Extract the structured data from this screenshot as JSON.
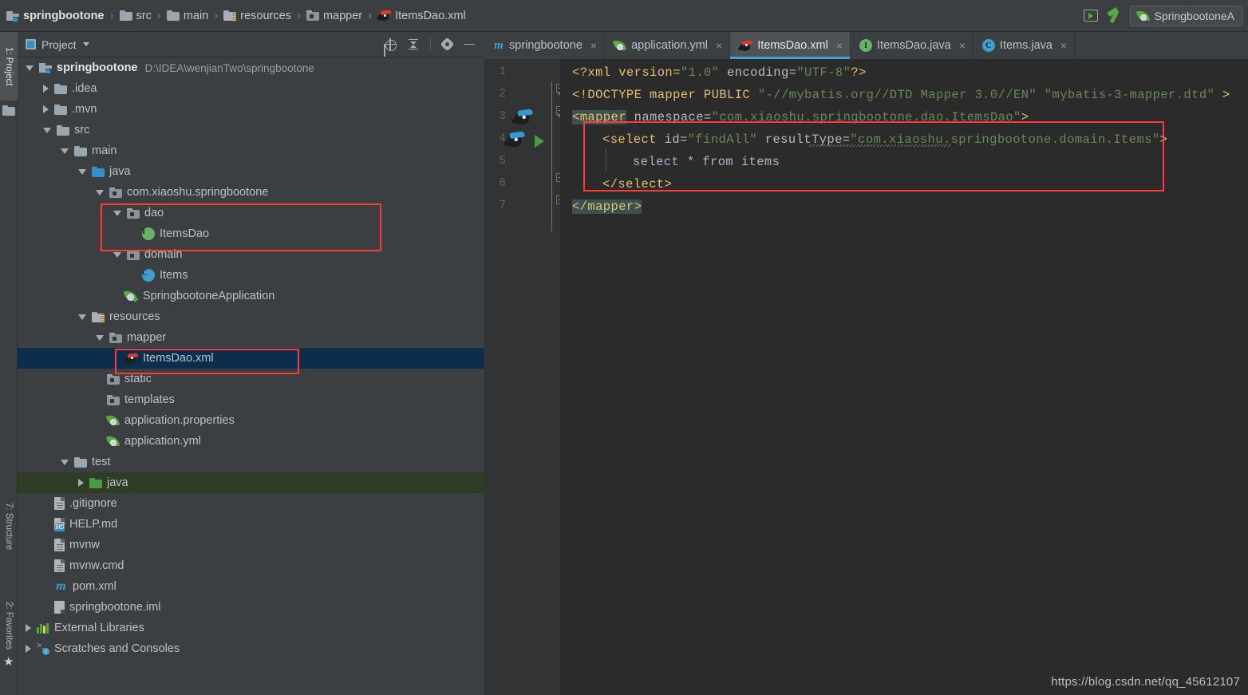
{
  "breadcrumb": {
    "items": [
      {
        "label": "springbootone",
        "icon": "project-module-icon"
      },
      {
        "label": "src",
        "icon": "folder-icon"
      },
      {
        "label": "main",
        "icon": "folder-icon"
      },
      {
        "label": "resources",
        "icon": "resources-folder-icon"
      },
      {
        "label": "mapper",
        "icon": "package-folder-icon"
      },
      {
        "label": "ItemsDao.xml",
        "icon": "mybatis-file-icon"
      }
    ],
    "separator": "›"
  },
  "toolbar": {
    "run_icon": "run-console-icon",
    "build_icon": "build-hammer-icon",
    "run_config_label": "SpringbootoneA",
    "run_config_icon": "spring-boot-icon"
  },
  "left_strip": {
    "tabs": [
      {
        "label": "1: Project",
        "active": true
      },
      {
        "label": "7: Structure",
        "active": false
      },
      {
        "label": "2: Favorites",
        "active": false
      }
    ]
  },
  "project_panel": {
    "title": "Project",
    "tools": [
      {
        "name": "locate-icon",
        "label": "Select Opened File"
      },
      {
        "name": "collapse-all-icon",
        "label": "Collapse All"
      },
      {
        "name": "gear-icon",
        "label": "Settings"
      },
      {
        "name": "hide-icon",
        "label": "Hide"
      }
    ],
    "tree": [
      {
        "depth": 0,
        "arrow": "down",
        "icon": "project-module-icon",
        "label": "springbootone",
        "path": "D:\\IDEA\\wenjianTwo\\springbootone",
        "bold": true
      },
      {
        "depth": 1,
        "arrow": "right",
        "icon": "folder-icon",
        "label": ".idea"
      },
      {
        "depth": 1,
        "arrow": "right",
        "icon": "folder-icon",
        "label": ".mvn"
      },
      {
        "depth": 1,
        "arrow": "down",
        "icon": "folder-icon",
        "label": "src"
      },
      {
        "depth": 2,
        "arrow": "down",
        "icon": "folder-icon",
        "label": "main"
      },
      {
        "depth": 3,
        "arrow": "down",
        "icon": "source-folder-icon",
        "label": "java"
      },
      {
        "depth": 4,
        "arrow": "down",
        "icon": "package-folder-icon",
        "label": "com.xiaoshu.springbootone"
      },
      {
        "depth": 5,
        "arrow": "down",
        "icon": "package-folder-icon",
        "label": "dao"
      },
      {
        "depth": 6,
        "arrow": "none",
        "icon": "interface-icon",
        "label": "ItemsDao"
      },
      {
        "depth": 5,
        "arrow": "down",
        "icon": "package-folder-icon",
        "label": "domain"
      },
      {
        "depth": 6,
        "arrow": "none",
        "icon": "class-icon",
        "label": "Items"
      },
      {
        "depth": 5,
        "arrow": "none",
        "icon": "spring-boot-app-icon",
        "label": "SpringbootoneApplication"
      },
      {
        "depth": 3,
        "arrow": "down",
        "icon": "resources-folder-icon",
        "label": "resources"
      },
      {
        "depth": 4,
        "arrow": "down",
        "icon": "package-folder-icon",
        "label": "mapper"
      },
      {
        "depth": 5,
        "arrow": "none",
        "icon": "mybatis-file-icon",
        "label": "ItemsDao.xml",
        "selected": true
      },
      {
        "depth": 4,
        "arrow": "none",
        "icon": "package-folder-icon",
        "label": "static"
      },
      {
        "depth": 4,
        "arrow": "none",
        "icon": "package-folder-icon",
        "label": "templates"
      },
      {
        "depth": 4,
        "arrow": "none",
        "icon": "spring-config-icon",
        "label": "application.properties"
      },
      {
        "depth": 4,
        "arrow": "none",
        "icon": "spring-config-icon",
        "label": "application.yml"
      },
      {
        "depth": 2,
        "arrow": "down",
        "icon": "folder-icon",
        "label": "test"
      },
      {
        "depth": 3,
        "arrow": "right",
        "icon": "test-source-folder-icon",
        "label": "java",
        "green": true
      },
      {
        "depth": 1,
        "arrow": "none",
        "icon": "file-icon",
        "label": ".gitignore"
      },
      {
        "depth": 1,
        "arrow": "none",
        "icon": "markdown-file-icon",
        "label": "HELP.md"
      },
      {
        "depth": 1,
        "arrow": "none",
        "icon": "file-icon",
        "label": "mvnw"
      },
      {
        "depth": 1,
        "arrow": "none",
        "icon": "file-icon",
        "label": "mvnw.cmd"
      },
      {
        "depth": 1,
        "arrow": "none",
        "icon": "maven-file-icon",
        "label": "pom.xml"
      },
      {
        "depth": 1,
        "arrow": "none",
        "icon": "iml-file-icon",
        "label": "springbootone.iml"
      },
      {
        "depth": 0,
        "arrow": "right",
        "icon": "external-libraries-icon",
        "label": "External Libraries"
      },
      {
        "depth": 0,
        "arrow": "right",
        "icon": "scratches-icon",
        "label": "Scratches and Consoles"
      }
    ]
  },
  "editor": {
    "tabs": [
      {
        "label": "springbootone",
        "icon": "maven-file-icon",
        "active": false,
        "close": "×"
      },
      {
        "label": "application.yml",
        "icon": "spring-config-icon",
        "active": false,
        "close": "×"
      },
      {
        "label": "ItemsDao.xml",
        "icon": "mybatis-file-icon",
        "active": true,
        "close": "×"
      },
      {
        "label": "ItemsDao.java",
        "icon": "interface-icon",
        "active": false,
        "close": "×"
      },
      {
        "label": "Items.java",
        "icon": "class-icon",
        "active": false,
        "close": "×"
      }
    ],
    "line_numbers": [
      "1",
      "2",
      "3",
      "4",
      "5",
      "6",
      "7"
    ],
    "code": {
      "l1": {
        "p1": "<?xml version=",
        "s1": "\"1.0\"",
        "p2": " encoding=",
        "s2": "\"UTF-8\"",
        "p3": "?>"
      },
      "l2": {
        "p1": "<!DOCTYPE mapper PUBLIC ",
        "s1": "\"-//mybatis.org//DTD Mapper 3.0//EN\" \"mybatis-3-mapper.dtd\"",
        "p2": " >"
      },
      "l3": {
        "tag": "<mapper",
        "attr": " namespace=",
        "val": "\"com.xiaoshu.springbootone.dao.ItemsDao\"",
        "close": ">"
      },
      "l4": {
        "tag": "<select",
        "a1": " id=",
        "v1": "\"findAll\"",
        "a2": " resultType=",
        "v2": "\"com.xiaoshu.springbootone.domain.Items\"",
        "close": ">"
      },
      "l5": {
        "text": "select * from items"
      },
      "l6": {
        "tag": "</select>"
      },
      "l7": {
        "tag": "</mapper>"
      }
    },
    "gutter_icons": [
      {
        "line": 3,
        "name": "mybatis-mapper-gutter-icon"
      },
      {
        "line": 4,
        "name": "mybatis-statement-gutter-icon"
      },
      {
        "line": 4,
        "name": "run-statement-gutter-icon"
      }
    ]
  },
  "annotations": {
    "boxes": [
      {
        "name": "dao-package-highlight"
      },
      {
        "name": "items-dao-xml-highlight"
      },
      {
        "name": "select-statement-highlight"
      }
    ],
    "color": "#fa3c3c"
  },
  "watermark": "https://blog.csdn.net/qq_45612107"
}
